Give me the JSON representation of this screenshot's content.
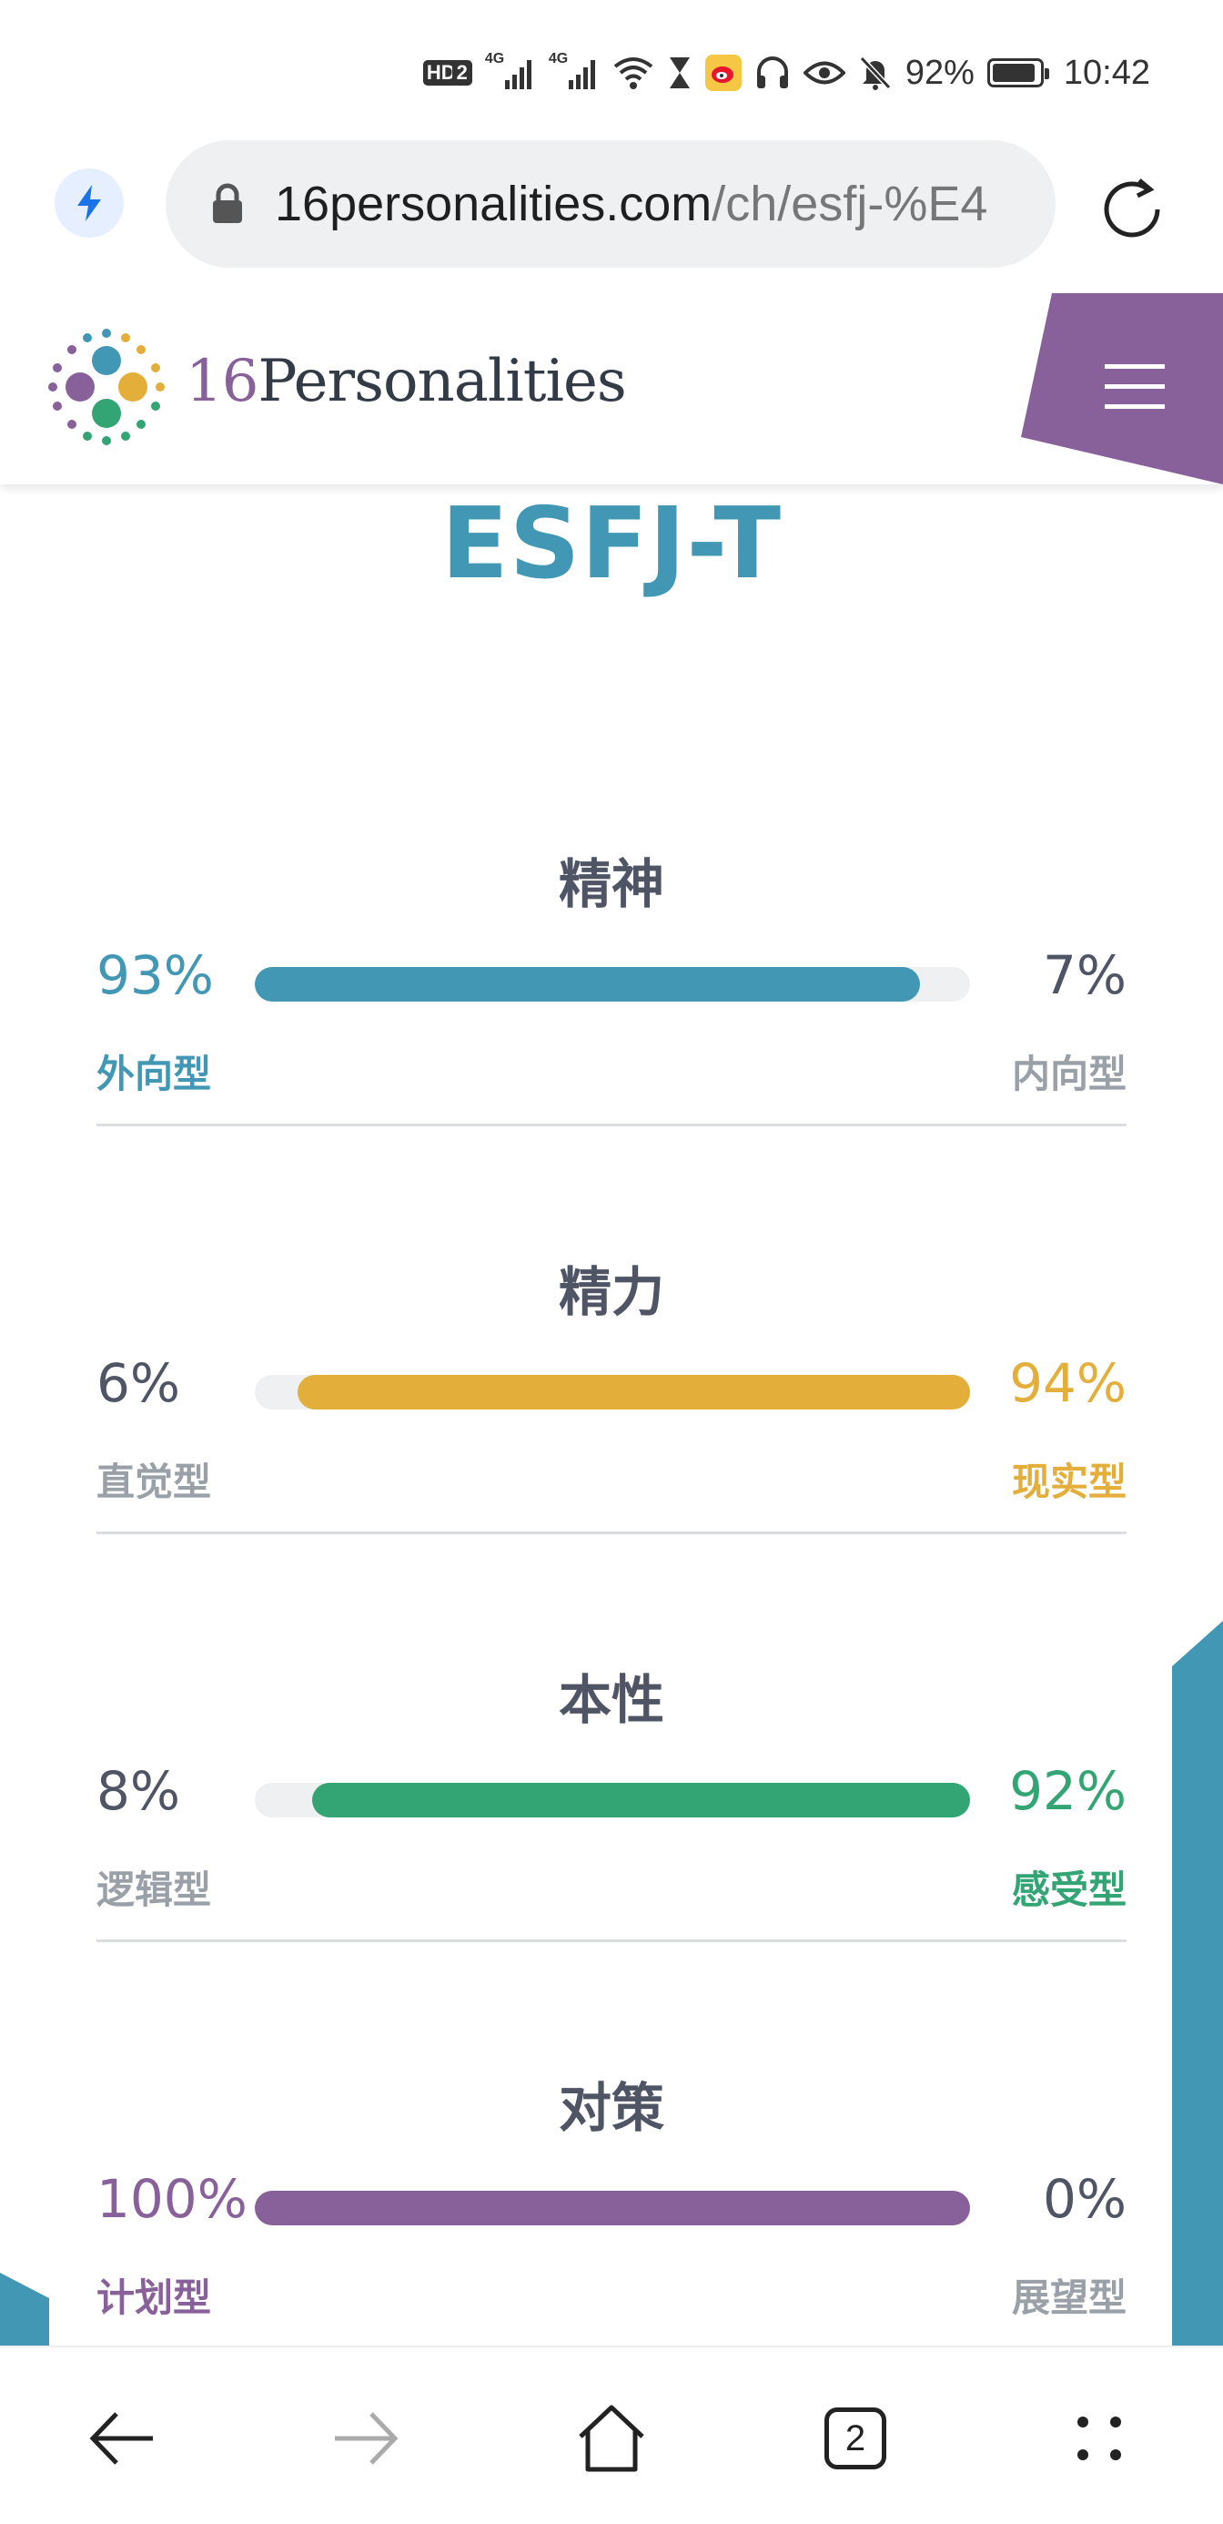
{
  "status_bar": {
    "hd_label": "HD",
    "sim_label": "2",
    "network_1": "4G",
    "network_2": "4G",
    "battery_text": "92%",
    "battery_level": 0.92,
    "time": "10:42"
  },
  "browser": {
    "url_host": "16personalities.com",
    "url_path": "/ch/esfj-%E4",
    "tab_count": "2"
  },
  "site": {
    "brand_number": "16",
    "brand_name": "Personalities",
    "colors": {
      "blue": "#4298b4",
      "yellow": "#e4ae3a",
      "green": "#33a474",
      "purple": "#88619a",
      "text": "#4f5565",
      "muted": "#9aa0a8"
    }
  },
  "result": {
    "type_code": "ESFJ-T",
    "traits": [
      {
        "title": "精神",
        "left_pct": "93%",
        "right_pct": "7%",
        "left_label": "外向型",
        "right_label": "内向型",
        "dominant": "left",
        "value": 0.93,
        "color": "#4298b4"
      },
      {
        "title": "精力",
        "left_pct": "6%",
        "right_pct": "94%",
        "left_label": "直觉型",
        "right_label": "现实型",
        "dominant": "right",
        "value": 0.94,
        "color": "#e4ae3a"
      },
      {
        "title": "本性",
        "left_pct": "8%",
        "right_pct": "92%",
        "left_label": "逻辑型",
        "right_label": "感受型",
        "dominant": "right",
        "value": 0.92,
        "color": "#33a474"
      },
      {
        "title": "对策",
        "left_pct": "100%",
        "right_pct": "0%",
        "left_label": "计划型",
        "right_label": "展望型",
        "dominant": "left",
        "value": 1.0,
        "color": "#88619a"
      }
    ]
  }
}
